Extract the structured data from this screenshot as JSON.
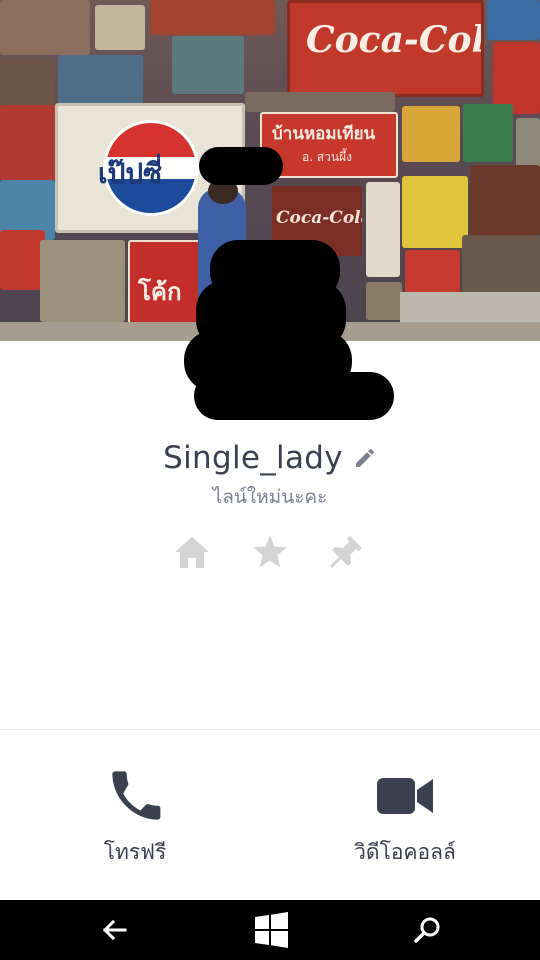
{
  "profile": {
    "name": "Single_lady",
    "status_message": "ไลน์ใหม่นะคะ"
  },
  "cover": {
    "sign_texts": [
      "Coca-Cola",
      "เป๊ปซี่",
      "บ้านหอมเทียน",
      "อ. สวนผึ้ง",
      "Coca-Cola",
      "โค้ก"
    ]
  },
  "actions": {
    "icons": [
      "home-icon",
      "star-icon",
      "pin-icon"
    ]
  },
  "calls": {
    "free_call_label": "โทรฟรี",
    "video_call_label": "วิดีโอคอลล์"
  },
  "navbar": {
    "icons": [
      "back-arrow-icon",
      "windows-start-icon",
      "search-icon"
    ]
  },
  "colors": {
    "name_text": "#3a404f",
    "status_text": "#7d8290",
    "icon_gray": "#d4d4d4",
    "call_icon": "#3a404f",
    "navbar_bg": "#000000"
  }
}
